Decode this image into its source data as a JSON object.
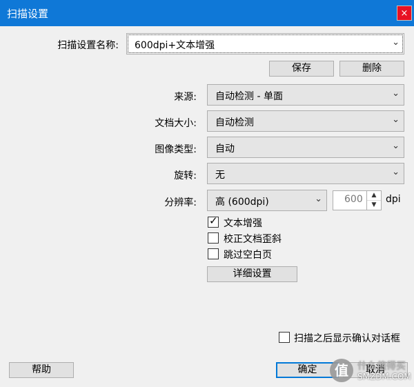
{
  "window": {
    "title": "扫描设置",
    "close_glyph": "×"
  },
  "profile": {
    "label": "扫描设置名称:",
    "value": "600dpi+文本增强",
    "save_label": "保存",
    "delete_label": "删除"
  },
  "source": {
    "label": "来源:",
    "value": "自动检测  - 单面"
  },
  "doc_size": {
    "label": "文档大小:",
    "value": "自动检测"
  },
  "image_type": {
    "label": "图像类型:",
    "value": "自动"
  },
  "rotation": {
    "label": "旋转:",
    "value": "无"
  },
  "resolution": {
    "label": "分辨率:",
    "value": "高 (600dpi)",
    "dpi_value": "600",
    "unit": "dpi"
  },
  "options": [
    {
      "label": "文本增强",
      "checked": true
    },
    {
      "label": "校正文档歪斜",
      "checked": false
    },
    {
      "label": "跳过空白页",
      "checked": false
    }
  ],
  "detail_button": "详细设置",
  "confirm_dialog": {
    "label": "扫描之后显示确认对话框",
    "checked": false
  },
  "footer": {
    "help_label": "帮助",
    "ok_label": "确定",
    "cancel_label": "取消"
  },
  "watermark": {
    "line1": "什么值得买",
    "line2": "SMZDM.COM",
    "icon_char": "值"
  }
}
